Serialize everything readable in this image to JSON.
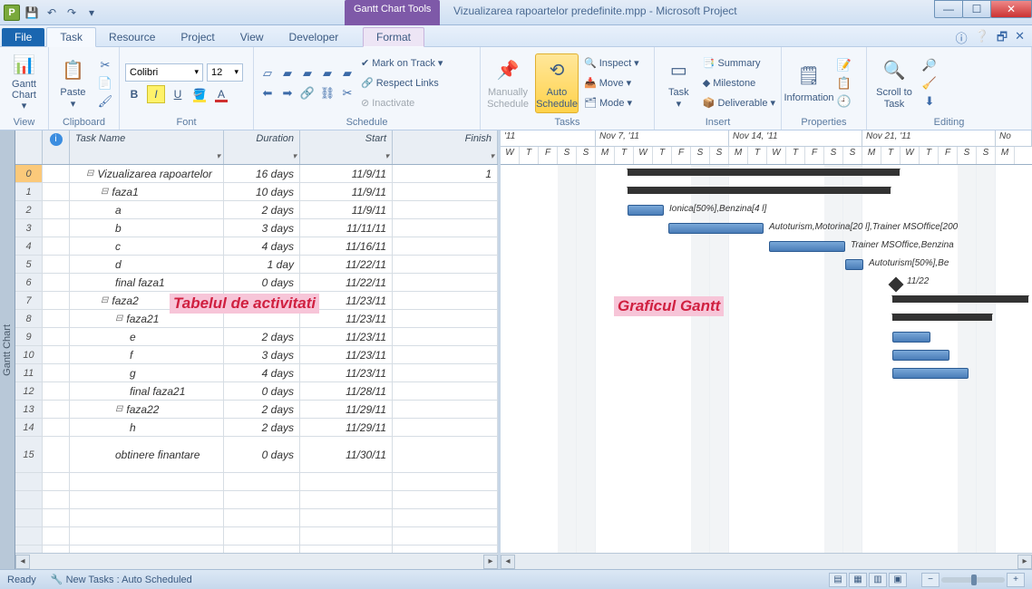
{
  "window": {
    "contextual_tab_title": "Gantt Chart Tools",
    "title": "Vizualizarea rapoartelor predefinite.mpp  -  Microsoft Project"
  },
  "tabs": {
    "file": "File",
    "list": [
      "Task",
      "Resource",
      "Project",
      "View",
      "Developer"
    ],
    "active": "Task",
    "context": "Format"
  },
  "ribbon": {
    "view_group": "View",
    "gantt_chart": "Gantt Chart",
    "clipboard_group": "Clipboard",
    "paste": "Paste",
    "font_group": "Font",
    "font_name": "Colibri",
    "font_size": "12",
    "schedule_group": "Schedule",
    "mark_on_track": "Mark on Track",
    "respect_links": "Respect Links",
    "inactivate": "Inactivate",
    "tasks_group": "Tasks",
    "manually_schedule": "Manually Schedule",
    "auto_schedule": "Auto Schedule",
    "inspect": "Inspect",
    "move": "Move",
    "mode": "Mode",
    "insert_group": "Insert",
    "task": "Task",
    "summary": "Summary",
    "milestone": "Milestone",
    "deliverable": "Deliverable",
    "properties_group": "Properties",
    "information": "Information",
    "editing_group": "Editing",
    "scroll_to_task": "Scroll to Task"
  },
  "sidestrip": "Gantt Chart",
  "table": {
    "headers": {
      "info": "",
      "name": "Task Name",
      "duration": "Duration",
      "start": "Start",
      "finish": "Finish"
    },
    "rows": [
      {
        "n": "0",
        "name": "Vizualizarea rapoartelor",
        "dur": "16 days",
        "start": "11/9/11",
        "fin": "1",
        "ind": 0,
        "exp": "-"
      },
      {
        "n": "1",
        "name": "faza1",
        "dur": "10 days",
        "start": "11/9/11",
        "fin": "",
        "ind": 1,
        "exp": "-"
      },
      {
        "n": "2",
        "name": "a",
        "dur": "2 days",
        "start": "11/9/11",
        "fin": "",
        "ind": 2
      },
      {
        "n": "3",
        "name": "b",
        "dur": "3 days",
        "start": "11/11/11",
        "fin": "",
        "ind": 2
      },
      {
        "n": "4",
        "name": "c",
        "dur": "4 days",
        "start": "11/16/11",
        "fin": "",
        "ind": 2
      },
      {
        "n": "5",
        "name": "d",
        "dur": "1 day",
        "start": "11/22/11",
        "fin": "",
        "ind": 2
      },
      {
        "n": "6",
        "name": "final faza1",
        "dur": "0 days",
        "start": "11/22/11",
        "fin": "",
        "ind": 2
      },
      {
        "n": "7",
        "name": "faza2",
        "dur": "",
        "start": "11/23/11",
        "fin": "",
        "ind": 1,
        "exp": "-"
      },
      {
        "n": "8",
        "name": "faza21",
        "dur": "",
        "start": "11/23/11",
        "fin": "",
        "ind": 2,
        "exp": "-"
      },
      {
        "n": "9",
        "name": "e",
        "dur": "2 days",
        "start": "11/23/11",
        "fin": "",
        "ind": 3
      },
      {
        "n": "10",
        "name": "f",
        "dur": "3 days",
        "start": "11/23/11",
        "fin": "",
        "ind": 3
      },
      {
        "n": "11",
        "name": "g",
        "dur": "4 days",
        "start": "11/23/11",
        "fin": "",
        "ind": 3
      },
      {
        "n": "12",
        "name": "final faza21",
        "dur": "0 days",
        "start": "11/28/11",
        "fin": "",
        "ind": 3
      },
      {
        "n": "13",
        "name": "faza22",
        "dur": "2 days",
        "start": "11/29/11",
        "fin": "",
        "ind": 2,
        "exp": "-"
      },
      {
        "n": "14",
        "name": "h",
        "dur": "2 days",
        "start": "11/29/11",
        "fin": "",
        "ind": 3
      },
      {
        "n": "15",
        "name": "obtinere finantare",
        "dur": "0 days",
        "start": "11/30/11",
        "fin": "",
        "ind": 2
      }
    ]
  },
  "annotations": {
    "table": "Tabelul de activitati",
    "gantt": "Graficul Gantt"
  },
  "timeline": {
    "part_week": "'11",
    "weeks": [
      "Nov 7, '11",
      "Nov 14, '11",
      "Nov 21, '11"
    ],
    "next": "No",
    "days": [
      "W",
      "T",
      "F",
      "S",
      "S",
      "M",
      "T",
      "W",
      "T",
      "F",
      "S",
      "S",
      "M",
      "T",
      "W",
      "T",
      "F",
      "S",
      "S",
      "M",
      "T",
      "W",
      "T",
      "F",
      "S",
      "S",
      "M"
    ]
  },
  "gantt": {
    "labels": {
      "a": "Ionica[50%],Benzina[4 l]",
      "b": "Autoturism,Motorina[20 l],Trainer MSOffice[200",
      "c": "Trainer MSOffice,Benzina",
      "d": "Autoturism[50%],Be",
      "ms": "11/22"
    }
  },
  "status": {
    "ready": "Ready",
    "newtasks": "New Tasks : Auto Scheduled"
  }
}
